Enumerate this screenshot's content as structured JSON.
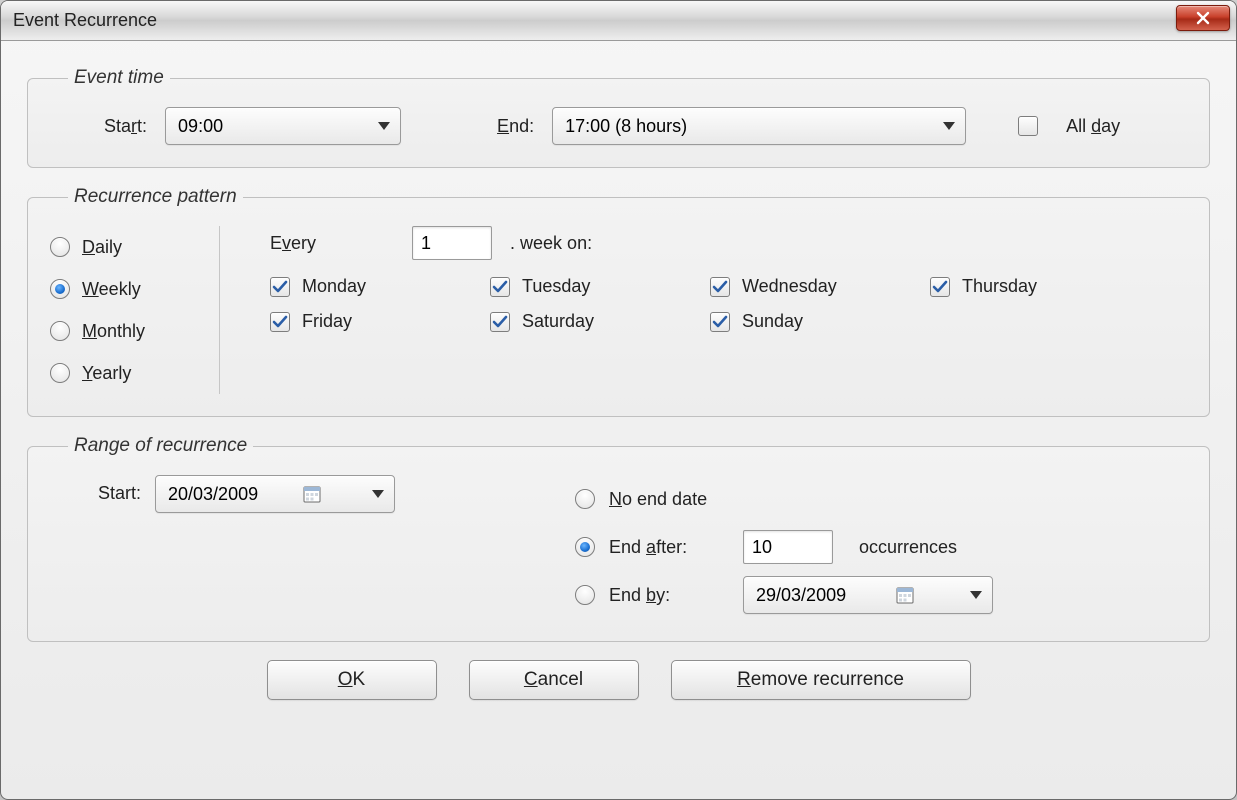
{
  "window": {
    "title": "Event Recurrence"
  },
  "event_time": {
    "legend": "Event time",
    "start_label": "Start:",
    "start_value": "09:00",
    "end_label": "End:",
    "end_value": "17:00 (8 hours)",
    "all_day_label": "All day",
    "all_day_checked": false
  },
  "pattern": {
    "legend": "Recurrence pattern",
    "freq": [
      {
        "key": "daily",
        "label": "Daily",
        "checked": false
      },
      {
        "key": "weekly",
        "label": "Weekly",
        "checked": true
      },
      {
        "key": "monthly",
        "label": "Monthly",
        "checked": false
      },
      {
        "key": "yearly",
        "label": "Yearly",
        "checked": false
      }
    ],
    "every_label": "Every",
    "every_value": "1",
    "week_on_label": ". week on:",
    "days": [
      {
        "label": "Monday",
        "checked": true
      },
      {
        "label": "Tuesday",
        "checked": true
      },
      {
        "label": "Wednesday",
        "checked": true
      },
      {
        "label": "Thursday",
        "checked": true
      },
      {
        "label": "Friday",
        "checked": true
      },
      {
        "label": "Saturday",
        "checked": true
      },
      {
        "label": "Sunday",
        "checked": true
      }
    ]
  },
  "range": {
    "legend": "Range of recurrence",
    "start_label": "Start:",
    "start_value": "20/03/2009",
    "options": [
      {
        "key": "no_end",
        "label": "No end date",
        "checked": false
      },
      {
        "key": "end_after",
        "label": "End after:",
        "checked": true
      },
      {
        "key": "end_by",
        "label": "End by:",
        "checked": false
      }
    ],
    "occurrences_value": "10",
    "occurrences_label": "occurrences",
    "end_by_value": "29/03/2009"
  },
  "buttons": {
    "ok": "OK",
    "cancel": "Cancel",
    "remove": "Remove recurrence"
  }
}
